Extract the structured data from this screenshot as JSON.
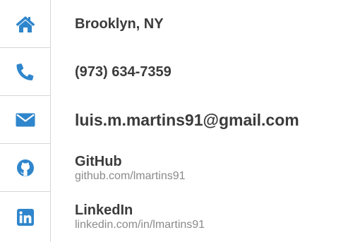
{
  "contact": {
    "items": [
      {
        "icon": "home-icon",
        "label": "Brooklyn, NY"
      },
      {
        "icon": "phone-icon",
        "label": "(973) 634-7359"
      },
      {
        "icon": "envelope-icon",
        "label": "luis.m.martins91@gmail.com"
      },
      {
        "icon": "github-icon",
        "label": "GitHub",
        "link": "github.com/lmartins91"
      },
      {
        "icon": "linkedin-icon",
        "label": "LinkedIn",
        "link": "linkedin.com/in/lmartins91"
      }
    ]
  },
  "colors": {
    "icon": "#2f86cc",
    "label": "#3b3b3b",
    "link": "#8a8a8a",
    "divider": "#d6d6d6"
  }
}
